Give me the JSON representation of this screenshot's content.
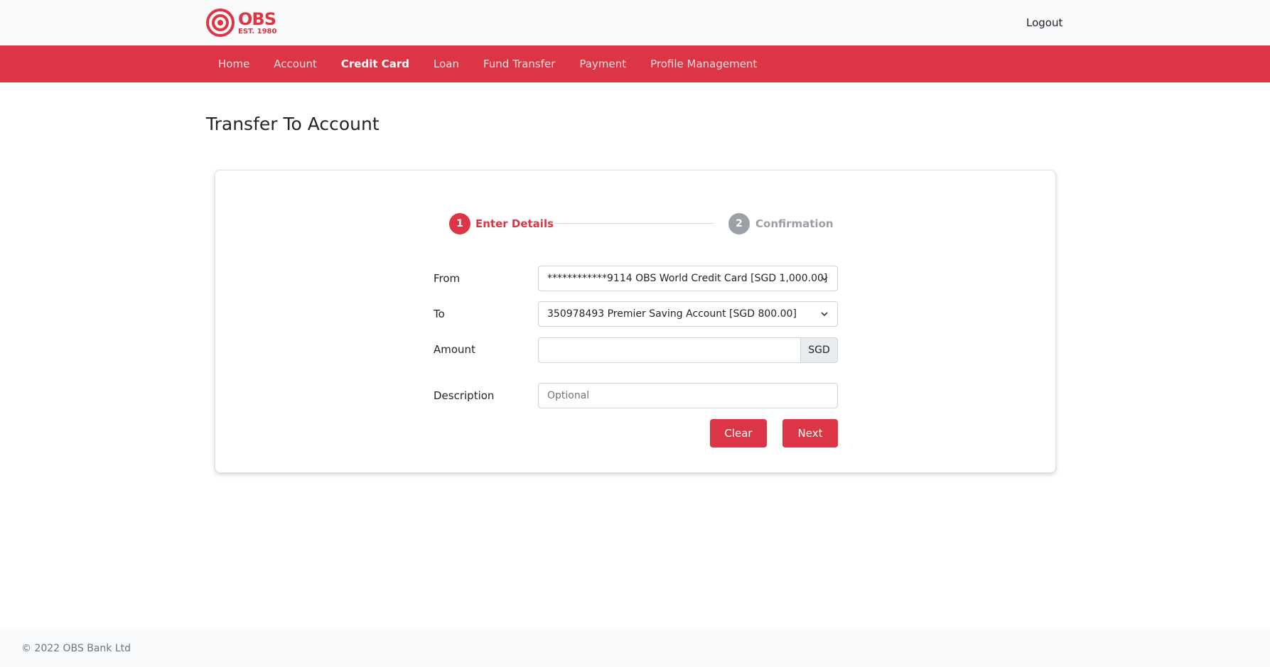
{
  "brand": {
    "name": "OBS",
    "established": "EST. 1980",
    "color": "#dc3545"
  },
  "header": {
    "logout_label": "Logout"
  },
  "nav": {
    "items": [
      {
        "label": "Home",
        "active": false
      },
      {
        "label": "Account",
        "active": false
      },
      {
        "label": "Credit Card",
        "active": true
      },
      {
        "label": "Loan",
        "active": false
      },
      {
        "label": "Fund Transfer",
        "active": false
      },
      {
        "label": "Payment",
        "active": false
      },
      {
        "label": "Profile Management",
        "active": false
      }
    ]
  },
  "page": {
    "title": "Transfer To Account"
  },
  "stepper": {
    "steps": [
      {
        "number": "1",
        "label": "Enter Details",
        "state": "active"
      },
      {
        "number": "2",
        "label": "Confirmation",
        "state": "inactive"
      }
    ]
  },
  "form": {
    "from": {
      "label": "From",
      "selected": "************9114 OBS World Credit Card [SGD 1,000.00]"
    },
    "to": {
      "label": "To",
      "selected": "350978493 Premier Saving Account [SGD 800.00]"
    },
    "amount": {
      "label": "Amount",
      "value": "",
      "currency": "SGD"
    },
    "description": {
      "label": "Description",
      "value": "",
      "placeholder": "Optional"
    },
    "buttons": {
      "clear_label": "Clear",
      "next_label": "Next"
    }
  },
  "footer": {
    "copyright": "© 2022 OBS Bank Ltd"
  }
}
